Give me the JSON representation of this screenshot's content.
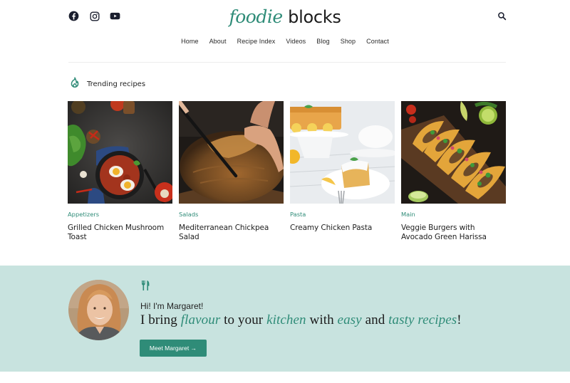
{
  "header": {
    "social": [
      {
        "name": "facebook-icon"
      },
      {
        "name": "instagram-icon"
      },
      {
        "name": "youtube-icon"
      }
    ],
    "logo_part1": "foodie",
    "logo_part2": "blocks",
    "search_icon": "search-icon"
  },
  "nav": {
    "items": [
      "Home",
      "About",
      "Recipe Index",
      "Videos",
      "Blog",
      "Shop",
      "Contact"
    ]
  },
  "trending": {
    "icon": "flame-icon",
    "label": "Trending recipes"
  },
  "recipes": [
    {
      "category": "Appetizers",
      "title": "Grilled Chicken Mushroom Toast",
      "image": "shakshuka-pan-photo"
    },
    {
      "category": "Salads",
      "title": "Mediterranean Chickpea Salad",
      "image": "sourdough-bread-photo"
    },
    {
      "category": "Pasta",
      "title": "Creamy Chicken Pasta",
      "image": "lemon-cake-photo"
    },
    {
      "category": "Main",
      "title": "Veggie Burgers with Avocado Green Harissa",
      "image": "tacos-photo"
    }
  ],
  "about": {
    "icon": "fork-knife-icon",
    "greeting": "Hi! I'm Margaret!",
    "tagline": {
      "t1": "I bring ",
      "e1": "flavour",
      "t2": " to your ",
      "e2": "kitchen",
      "t3": " with ",
      "e3": "easy",
      "t4": " and ",
      "e4": "tasty recipes",
      "t5": "!"
    },
    "button_label": "Meet Margaret →"
  },
  "colors": {
    "accent": "#2f8c78",
    "about_bg": "#c8e3df",
    "text": "#1b1b1b"
  }
}
